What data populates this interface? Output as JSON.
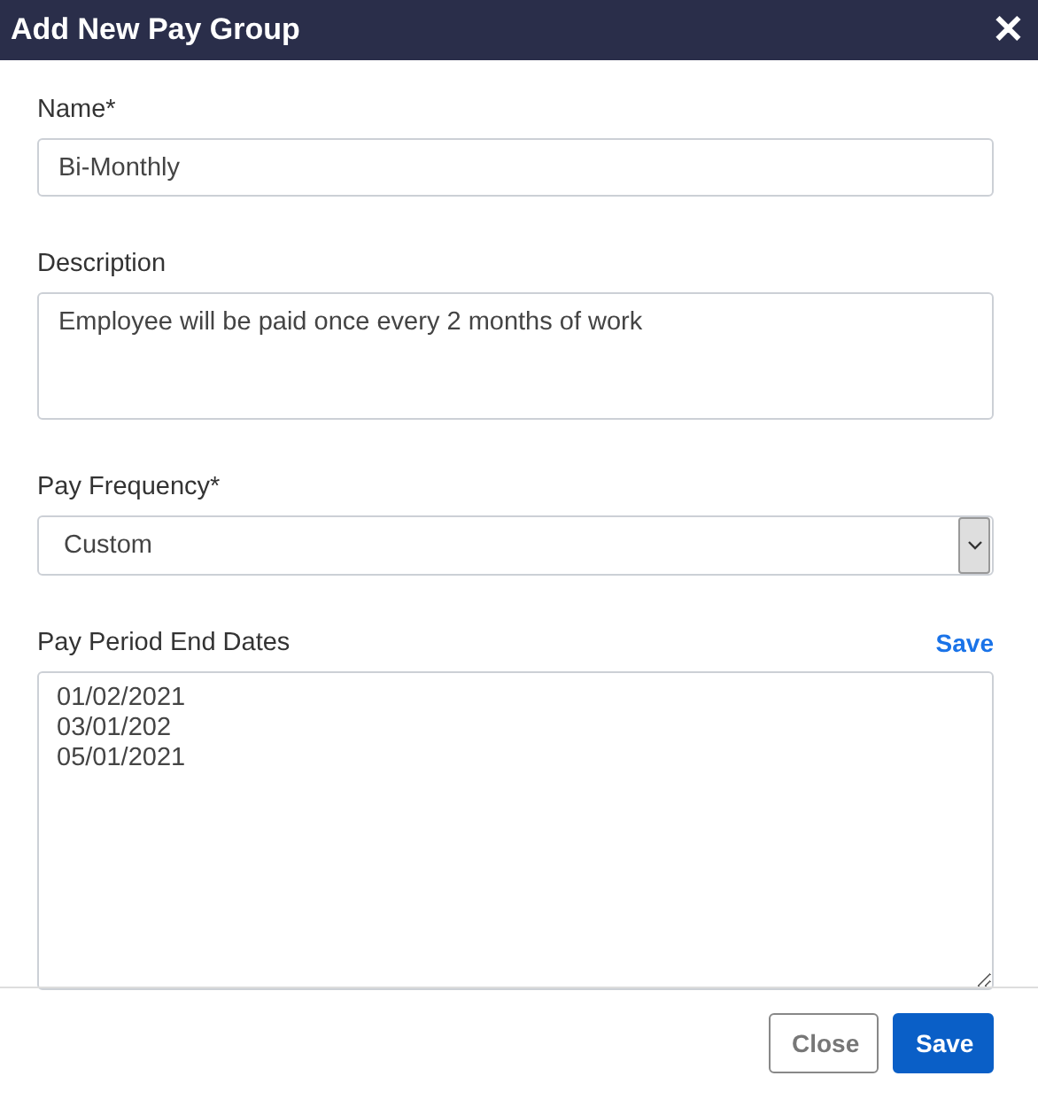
{
  "dialog": {
    "title": "Add New Pay Group",
    "close_icon": "✕"
  },
  "fields": [
    {
      "kind": "input",
      "label": "Name*",
      "value": "Bi-Monthly"
    },
    {
      "kind": "textarea",
      "label": "Description",
      "value": "Employee will be paid once every 2 months of work"
    },
    {
      "kind": "select",
      "label": "Pay Frequency*",
      "value": "Custom"
    },
    {
      "kind": "dates",
      "label": "Pay Period End Dates",
      "link": "Save",
      "values": [
        "01/02/2021",
        "03/01/202",
        "05/01/2021"
      ]
    }
  ],
  "buttons": [
    {
      "label": "Close",
      "kind": "secondary"
    },
    {
      "label": "Save",
      "kind": "primary"
    }
  ]
}
